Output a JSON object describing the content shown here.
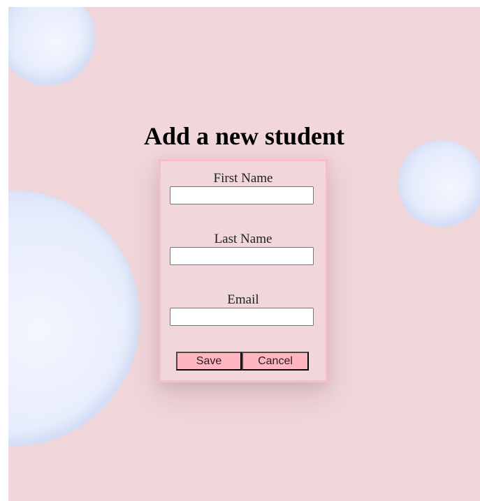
{
  "page": {
    "title": "Add a new student",
    "background_color": "#f1d6da",
    "accent_color": "#ffb6c1",
    "card_border_color": "#f9bdc8"
  },
  "form": {
    "fields": [
      {
        "label": "First Name",
        "value": "",
        "placeholder": ""
      },
      {
        "label": "Last Name",
        "value": "",
        "placeholder": ""
      },
      {
        "label": "Email",
        "value": "",
        "placeholder": ""
      }
    ],
    "buttons": {
      "save_label": "Save",
      "cancel_label": "Cancel"
    }
  }
}
